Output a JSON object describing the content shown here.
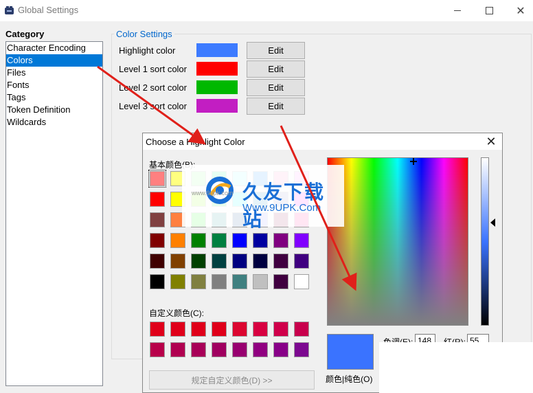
{
  "window": {
    "title": "Global Settings"
  },
  "category": {
    "label": "Category",
    "items": [
      "Character Encoding",
      "Colors",
      "Files",
      "Fonts",
      "Tags",
      "Token Definition",
      "Wildcards"
    ],
    "selected": "Colors"
  },
  "color_settings": {
    "title": "Color Settings",
    "rows": [
      {
        "label": "Highlight color",
        "color": "#3d7bff",
        "button": "Edit"
      },
      {
        "label": "Level 1 sort color",
        "color": "#ff0000",
        "button": "Edit"
      },
      {
        "label": "Level 2 sort color",
        "color": "#00b800",
        "button": "Edit"
      },
      {
        "label": "Level 3 sort color",
        "color": "#c21ec2",
        "button": "Edit"
      }
    ]
  },
  "dialog": {
    "title": "Choose a Highlight Color",
    "basic_label": "基本颜色(B):",
    "custom_label": "自定义颜色(C):",
    "define_button": "规定自定义颜色(D) >>",
    "hue_label": "色调(E):",
    "hue_value": "148",
    "red_label": "红(R):",
    "red_value": "55",
    "solid_label": "颜色|纯色(O)",
    "preview_color": "#3a73ff",
    "basic_colors": [
      [
        "#ff8080",
        "#ffff80",
        "#80ff80",
        "#00ff80",
        "#80ffff",
        "#0080ff",
        "#ff80c0",
        "#ff80ff"
      ],
      [
        "#ff0000",
        "#ffff00",
        "#80ff00",
        "#00ff40",
        "#00ffff",
        "#0080c0",
        "#8080c0",
        "#ff00ff"
      ],
      [
        "#804040",
        "#ff8040",
        "#00ff00",
        "#008080",
        "#004080",
        "#8080ff",
        "#800040",
        "#ff0080"
      ],
      [
        "#800000",
        "#ff8000",
        "#008000",
        "#008040",
        "#0000ff",
        "#0000a0",
        "#800080",
        "#8000ff"
      ],
      [
        "#400000",
        "#804000",
        "#004000",
        "#004040",
        "#000080",
        "#000040",
        "#400040",
        "#400080"
      ],
      [
        "#000000",
        "#808000",
        "#808040",
        "#808080",
        "#408080",
        "#c0c0c0",
        "#400040",
        "#ffffff"
      ]
    ],
    "custom_colors": [
      [
        "#e0001a",
        "#e0001a",
        "#e0001a",
        "#e0001a",
        "#dc0630",
        "#d80040",
        "#d0004a",
        "#c8004c"
      ],
      [
        "#b8004a",
        "#b00050",
        "#a80058",
        "#a00060",
        "#980070",
        "#900080",
        "#880088",
        "#7c0890"
      ]
    ]
  },
  "watermark": {
    "title": "久友下载站",
    "url": "Www.9UPK.Com",
    "small": "www.9upk.com"
  }
}
